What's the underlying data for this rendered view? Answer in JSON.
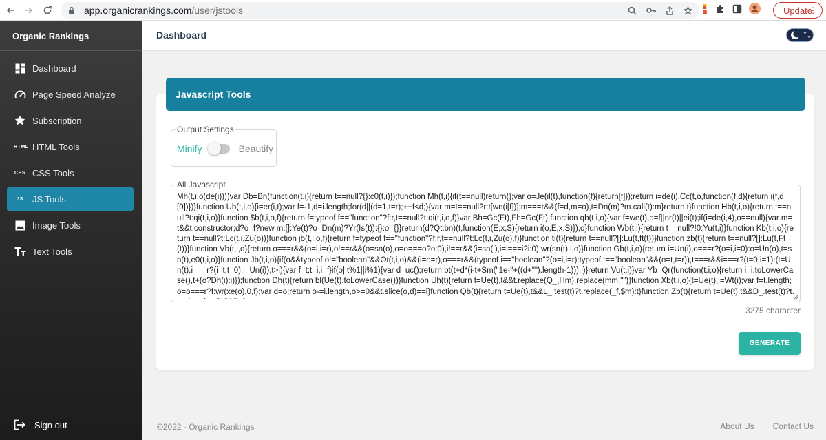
{
  "browser": {
    "url_host": "app.organicrankings.com",
    "url_path": "/user/jstools",
    "update_label": "Update"
  },
  "sidebar": {
    "brand": "Organic Rankings",
    "items": [
      {
        "label": "Dashboard",
        "icon": "dashboard-icon"
      },
      {
        "label": "Page Speed Analyze",
        "icon": "speedometer-icon"
      },
      {
        "label": "Subscription",
        "icon": "star-icon"
      },
      {
        "label": "HTML Tools",
        "icon": "html-icon",
        "icon_text": "HTML"
      },
      {
        "label": "CSS Tools",
        "icon": "css-icon",
        "icon_text": "CSS"
      },
      {
        "label": "JS Tools",
        "icon": "js-icon",
        "icon_text": "JS"
      },
      {
        "label": "Image Tools",
        "icon": "image-icon"
      },
      {
        "label": "Text Tools",
        "icon": "text-icon"
      }
    ],
    "signout": "Sign out"
  },
  "header": {
    "title": "Dashboard"
  },
  "tool": {
    "title": "Javascript Tools",
    "output_settings_label": "Output Settings",
    "minify_label": "Minify",
    "beautify_label": "Beautify",
    "code_label": "All Javascript",
    "code": "Mh(t,i,o(de(i))))var Db=Bn(function(t,i){return t==null?{}:c0(t,i)});function Mh(t,i){if(t==null)return{};var o=Je(il(t),function(f){return[f]});return i=de(i),Cc(t,o,function(f,d){return i(f,d[0])})}function Ub(t,i,o){i=er(i,t);var f=-1,d=i.length;for(d||(d=1,t=r);++f<d;){var m=t==null?r:t[wn(i[f])];m===r&&(f=d,m=o),t=Dn(m)?m.call(t):m}return t}function Hb(t,i,o){return t==null?t:qi(t,i,o)}function $b(t,i,o,f){return f=typeof f==\"function\"?f:r,t==null?t:qi(t,i,o,f)}var Bh=Gc(Ft),Fh=Gc(Ft);function qb(t,i,o){var f=we(t),d=f||nr(t)||ei(t);if(i=de(i,4),o==null){var m=t&&t.constructor;d?o=f?new m:[]:Ye(t)?o=Dn(m)?Yr(Is(t)):{}:o={}}return(d?Qt:bn)(t,function(E,x,S){return i(o,E,x,S)}),o}function Wb(t,i){return t==null?!0:Yu(t,i)}function Kb(t,i,o){return t==null?t:Lc(t,i,Zu(o))}function jb(t,i,o,f){return f=typeof f==\"function\"?f:r,t==null?t:Lc(t,i,Zu(o),f)}function ti(t){return t==null?[]:Lu(t,ft(t))}function zb(t){return t==null?[]:Lu(t,Ft(t))}function Vb(t,i,o){return o===r&&(o=i,i=r),o!==r&&(o=sn(o),o=o===o?o:0),i!==r&&(i=sn(i),i=i===i?i:0),wr(sn(t),i,o)}function Gb(t,i,o){return i=Un(i),o===r?(o=i,i=0):o=Un(o),t=sn(t),e0(t,i,o)}function Jb(t,i,o){if(o&&typeof o!=\"boolean\"&&Ot(t,i,o)&&(i=o=r),o===r&&(typeof i==\"boolean\"?(o=i,i=r):typeof t==\"boolean\"&&(o=t,t=r)),t===r&&i===r?(t=0,i=1):(t=Un(t),i===r?(i=t,t=0):i=Un(i)),t>i){var f=t;t=i,i=f}if(o||t%1||i%1){var d=uc();return bt(t+d*(i-t+Sm(\"1e-\"+((d+\"\").length-1))),i)}return Vu(t,i)}var Yb=Qr(function(t,i,o){return i=i.toLowerCase(),t+(o?Dh(i):i)});function Dh(t){return bl(Ue(t).toLowerCase())}function Uh(t){return t=Ue(t),t&&t.replace(Q_,Hm).replace(mm,\"\")}function Xb(t,i,o){t=Ue(t),i=Wt(i);var f=t.length;o=o===r?f:wr(xe(o),0,f);var d=o;return o-=i.length,o>=0&&t.slice(o,d)==i}function Qb(t){return t=Ue(t),t&&L_.test(t)?t.replace(_f,$m):t}function Zb(t){return t=Ue(t),t&&D_.test(t)?t.replace(gu,\"\\\\$&\"):t}var",
    "char_count": "3275 character",
    "generate_label": "GENERATE"
  },
  "footer": {
    "copyright": "©2022 - Organic Rankings",
    "links": [
      "About Us",
      "Contact Us"
    ]
  },
  "colors": {
    "accent": "#17809f",
    "active_menu": "#1e87a8",
    "teal": "#2bb3a3",
    "update_red": "#c6342f"
  }
}
